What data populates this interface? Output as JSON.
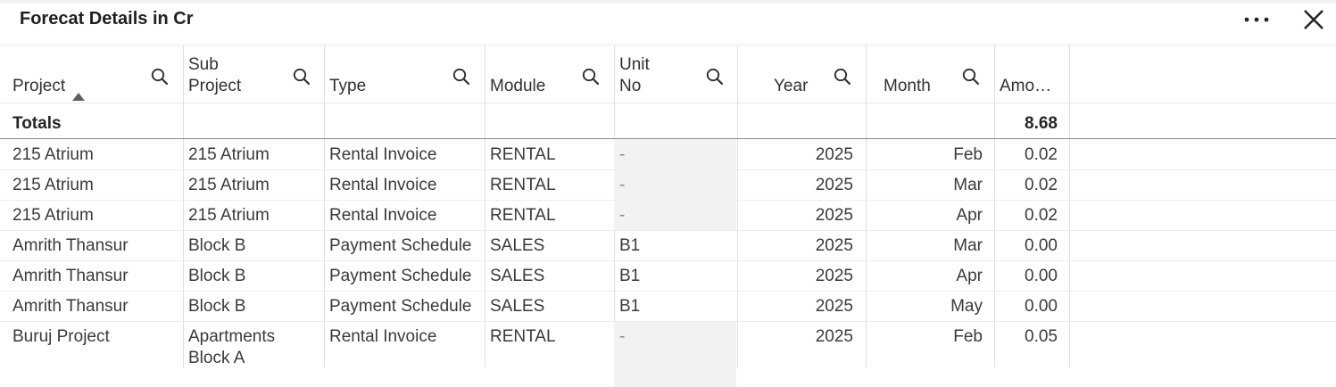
{
  "title": "Forecat Details in Cr",
  "toolbar": {
    "more_icon": "more-options-icon",
    "close_icon": "close-icon"
  },
  "columns": [
    {
      "label": "Project",
      "has_search": true,
      "sorted": "ascending"
    },
    {
      "label": "Sub\nProject",
      "has_search": true
    },
    {
      "label": "Type",
      "has_search": true
    },
    {
      "label": "Module",
      "has_search": true
    },
    {
      "label": "Unit\nNo",
      "has_search": true
    },
    {
      "label": "Year",
      "has_search": true
    },
    {
      "label": "Month",
      "has_search": true
    },
    {
      "label": "Amo…",
      "has_search": false
    }
  ],
  "totals": {
    "label": "Totals",
    "amount": "8.68"
  },
  "rows": [
    {
      "project": "215 Atrium",
      "sub_project": "215 Atrium",
      "type": "Rental Invoice",
      "module": "RENTAL",
      "unit_no": "-",
      "year": "2025",
      "month": "Feb",
      "amount": "0.02"
    },
    {
      "project": "215 Atrium",
      "sub_project": "215 Atrium",
      "type": "Rental Invoice",
      "module": "RENTAL",
      "unit_no": "-",
      "year": "2025",
      "month": "Mar",
      "amount": "0.02"
    },
    {
      "project": "215 Atrium",
      "sub_project": "215 Atrium",
      "type": "Rental Invoice",
      "module": "RENTAL",
      "unit_no": "-",
      "year": "2025",
      "month": "Apr",
      "amount": "0.02"
    },
    {
      "project": "Amrith Thansur",
      "sub_project": "Block B",
      "type": "Payment Schedule",
      "module": "SALES",
      "unit_no": "B1",
      "year": "2025",
      "month": "Mar",
      "amount": "0.00"
    },
    {
      "project": "Amrith Thansur",
      "sub_project": "Block B",
      "type": "Payment Schedule",
      "module": "SALES",
      "unit_no": "B1",
      "year": "2025",
      "month": "Apr",
      "amount": "0.00"
    },
    {
      "project": "Amrith Thansur",
      "sub_project": "Block B",
      "type": "Payment Schedule",
      "module": "SALES",
      "unit_no": "B1",
      "year": "2025",
      "month": "May",
      "amount": "0.00"
    },
    {
      "project": "Buruj Project",
      "sub_project": "Apartments\nBlock A",
      "type": "Rental Invoice",
      "module": "RENTAL",
      "unit_no": "-",
      "year": "2025",
      "month": "Feb",
      "amount": "0.05"
    }
  ]
}
